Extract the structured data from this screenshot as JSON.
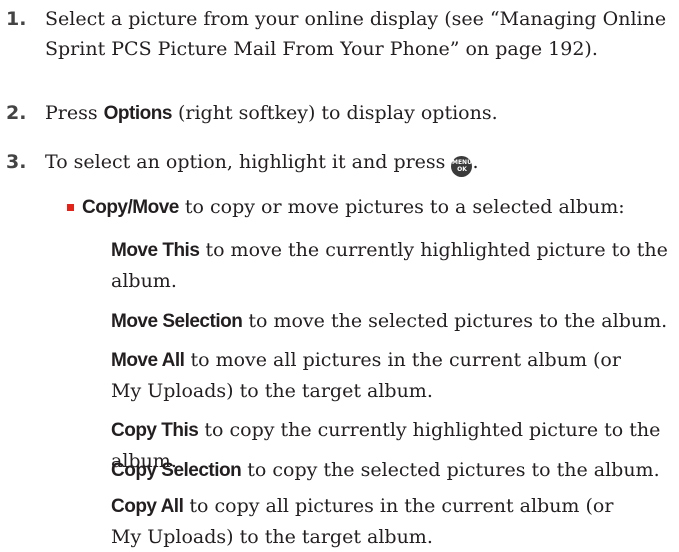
{
  "steps": [
    {
      "number": "1.",
      "text": "Select a picture from your online display (see “Managing Online Sprint PCS Picture Mail From Your Phone” on page 192)."
    },
    {
      "number": "2.",
      "bold": "Options",
      "text": " (right softkey) to display options.",
      "prefix": "Press "
    },
    {
      "number": "3.",
      "text": "To select an option, highlight it and press ",
      "suffix": "."
    }
  ],
  "menu_key": {
    "top": "MENU",
    "bottom": "OK",
    "icon": "menu-ok-key-icon"
  },
  "bullet": {
    "bold": "Copy/Move",
    "text": " to copy or move pictures to a selected album:"
  },
  "options": [
    {
      "bold": "Move This",
      "text": " to move the currently highlighted picture to the album."
    },
    {
      "bold": "Move Selection",
      "text": " to move the selected pictures to the album."
    },
    {
      "bold": "Move All",
      "text": " to move all pictures in the current album (or My Uploads) to the target album."
    },
    {
      "bold": "Copy This",
      "text": " to copy the currently highlighted picture to the album."
    },
    {
      "bold": "Copy Selection",
      "text": " to copy the selected pictures to the album."
    },
    {
      "bold": "Copy All",
      "text": " to copy all pictures in the current album (or My Uploads) to the target album."
    }
  ],
  "colors": {
    "bullet": "#e2231a",
    "text": "#231f20",
    "step_number": "#444444"
  }
}
